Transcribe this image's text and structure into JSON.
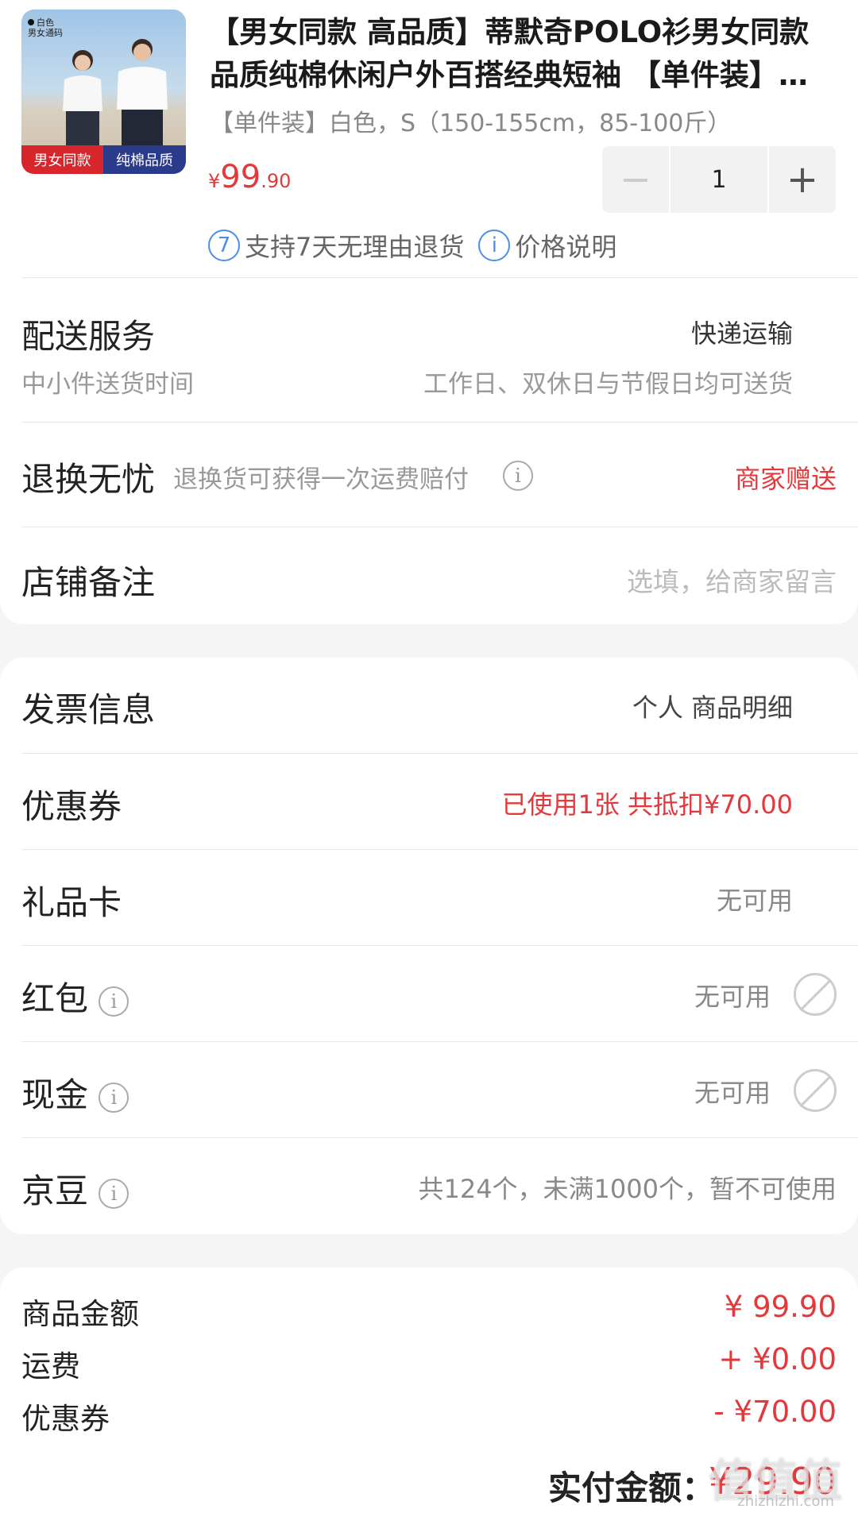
{
  "product": {
    "image_tag_line1": "白色",
    "image_tag_line2": "男女通码",
    "image_banner_left": "男女同款",
    "image_banner_right": "纯棉品质",
    "title": "【男女同款 高品质】蒂默奇POLO衫男女同款品质纯棉休闲户外百搭经典短袖 【单件装】白色",
    "variant": "【单件装】白色，S（150-155cm，85-100斤）",
    "price_symbol": "¥",
    "price_int": "99",
    "price_dec": ".90",
    "quantity": "1",
    "minus_label": "−",
    "plus_label": "+",
    "returns_icon": "7",
    "returns_text": "支持7天无理由退货",
    "price_info_icon": "i",
    "price_info_text": "价格说明"
  },
  "delivery": {
    "label": "配送服务",
    "value": "快递运输",
    "sub_label": "中小件送货时间",
    "sub_value": "工作日、双休日与节假日均可送货"
  },
  "exchange": {
    "label": "退换无忧",
    "desc": "退换货可获得一次运费赔付",
    "value": "商家赠送"
  },
  "note": {
    "label": "店铺备注",
    "placeholder": "选填，给商家留言"
  },
  "invoice": {
    "label": "发票信息",
    "value": "个人 商品明细"
  },
  "coupon": {
    "label": "优惠券",
    "value": "已使用1张 共抵扣¥70.00"
  },
  "giftcard": {
    "label": "礼品卡",
    "value": "无可用"
  },
  "redpacket": {
    "label": "红包",
    "value": "无可用"
  },
  "cash": {
    "label": "现金",
    "value": "无可用"
  },
  "jingdou": {
    "label": "京豆",
    "value": "共124个，未满1000个，暂不可使用"
  },
  "summary": {
    "goods_label": "商品金额",
    "goods_value": "¥ 99.90",
    "shipping_label": "运费",
    "shipping_value": "+ ¥0.00",
    "coupon_label": "优惠券",
    "coupon_value": "- ¥70.00",
    "total_label": "实付金额：",
    "total_value": "¥29.90"
  },
  "watermark": {
    "text": "值值值",
    "sub": "zhizhizhi.com"
  },
  "colors": {
    "accent_red": "#e4393c",
    "link_blue": "#4a8ee6"
  }
}
